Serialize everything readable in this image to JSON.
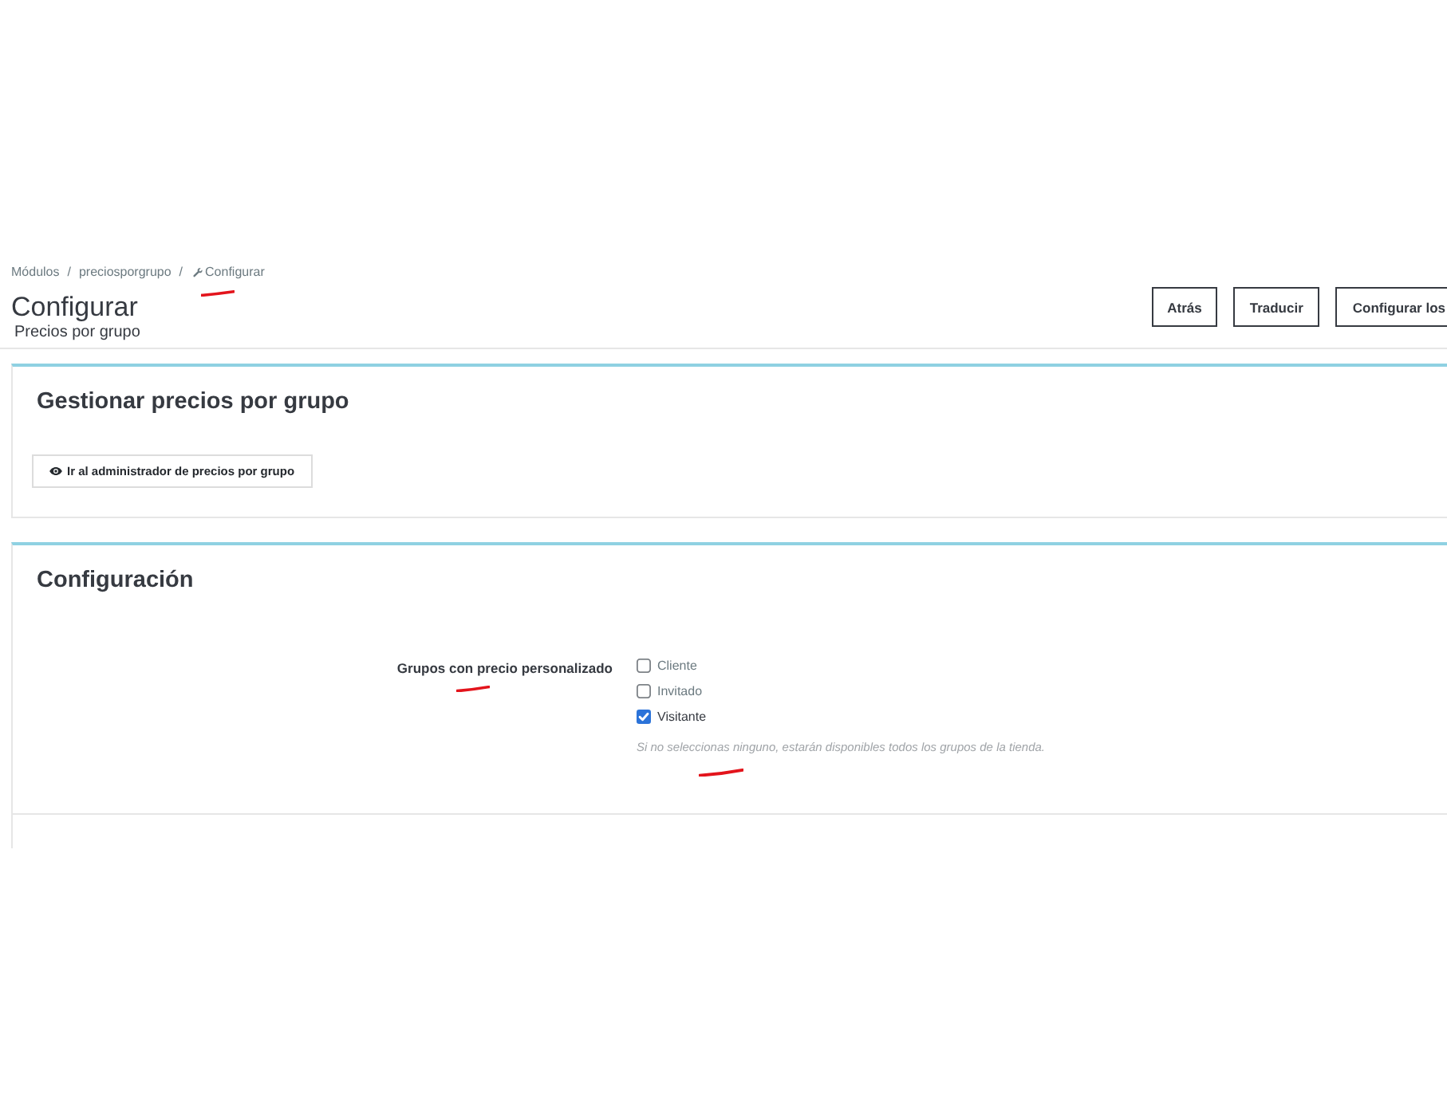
{
  "breadcrumb": [
    {
      "label": "Módulos",
      "kind": "link",
      "separator": "/",
      "annotated": false
    },
    {
      "label": "preciosporgrupo",
      "kind": "link",
      "separator": "/",
      "annotated": false
    },
    {
      "label": "Configurar",
      "kind": "current",
      "annotated": true
    }
  ],
  "header": {
    "title": "Configurar",
    "subtitle": "Precios por grupo",
    "buttons": [
      {
        "label": "Atrás"
      },
      {
        "label": "Traducir"
      },
      {
        "label": "Configurar los"
      }
    ]
  },
  "panels": [
    {
      "kind": "actions",
      "title": "Gestionar precios por grupo",
      "button": {
        "label": "Ir al administrador de precios por grupo"
      }
    },
    {
      "kind": "form",
      "title": "Configuración",
      "field": {
        "label": {
          "text": "Grupos con precio personalizado",
          "annotated": true
        },
        "options": [
          {
            "label": "Cliente",
            "checked": false
          },
          {
            "label": "Invitado",
            "checked": false
          },
          {
            "label": "Visitante",
            "checked": true
          }
        ],
        "help": {
          "text": "Si no seleccionas ninguno, estarán disponibles todos los grupos de la tienda.",
          "annotated": true
        }
      }
    }
  ]
}
